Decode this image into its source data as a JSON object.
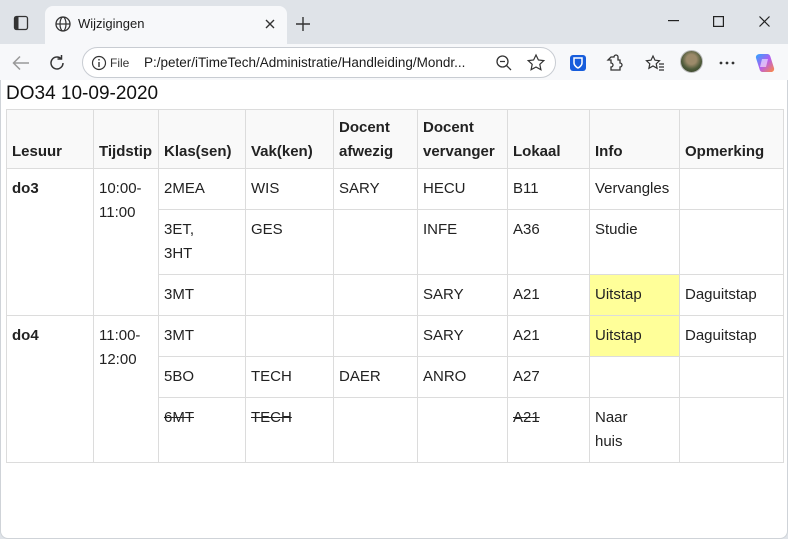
{
  "browser": {
    "tab_title": "Wijzigingen",
    "address_scheme": "File",
    "address_url": "P:/peter/iTimeTech/Administratie/Handleiding/Mondr..."
  },
  "page": {
    "title": "DO34 10-09-2020",
    "columns": [
      "Lesuur",
      "Tijdstip",
      "Klas(sen)",
      "Vak(ken)",
      "Docent afwezig",
      "Docent vervanger",
      "Lokaal",
      "Info",
      "Opmerking"
    ],
    "blocks": [
      {
        "hour": "do3",
        "time": "10:00-\n11:00",
        "rows": [
          {
            "klas": "2MEA",
            "vak": "WIS",
            "afwezig": "SARY",
            "vervanger": "HECU",
            "lokaal": "B11",
            "info": "Vervangles",
            "opmerking": "",
            "info_highlight": false,
            "cancelled": false
          },
          {
            "klas": "3ET,\n3HT",
            "vak": "GES",
            "afwezig": "",
            "vervanger": "INFE",
            "lokaal": "A36",
            "info": "Studie",
            "opmerking": "",
            "info_highlight": false,
            "cancelled": false
          },
          {
            "klas": "3MT",
            "vak": "",
            "afwezig": "",
            "vervanger": "SARY",
            "lokaal": "A21",
            "info": "Uitstap",
            "opmerking": "Daguitstap",
            "info_highlight": true,
            "cancelled": false
          }
        ]
      },
      {
        "hour": "do4",
        "time": "11:00-\n12:00",
        "rows": [
          {
            "klas": "3MT",
            "vak": "",
            "afwezig": "",
            "vervanger": "SARY",
            "lokaal": "A21",
            "info": "Uitstap",
            "opmerking": "Daguitstap",
            "info_highlight": true,
            "cancelled": false
          },
          {
            "klas": "5BO",
            "vak": "TECH",
            "afwezig": "DAER",
            "vervanger": "ANRO",
            "lokaal": "A27",
            "info": "",
            "opmerking": "",
            "info_highlight": false,
            "cancelled": false
          },
          {
            "klas": "6MT",
            "vak": "TECH",
            "afwezig": "",
            "vervanger": "",
            "lokaal": "A21",
            "info": "Naar\nhuis",
            "opmerking": "",
            "info_highlight": false,
            "cancelled": true
          }
        ]
      }
    ],
    "highlight_color": "#ffff99"
  }
}
